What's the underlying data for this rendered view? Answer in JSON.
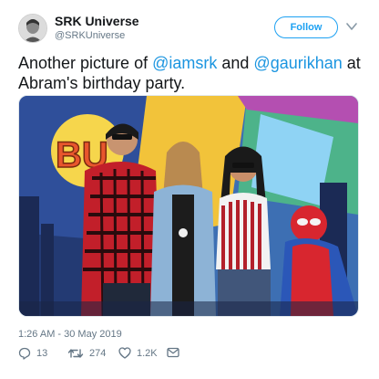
{
  "account": {
    "name": "SRK Universe",
    "handle": "@SRKUniverse"
  },
  "follow_label": "Follow",
  "tweet": {
    "part1": "Another picture of ",
    "mention1": "@iamsrk",
    "part2": " and ",
    "mention2": "@gaurikhan",
    "part3": " at Abram's birthday party."
  },
  "photo": {
    "wall_text": "BU"
  },
  "timestamp": "1:26 AM - 30 May 2019",
  "actions": {
    "replies": "13",
    "retweets": "274",
    "likes": "1.2K"
  },
  "colors": {
    "accent": "#1da1f2",
    "mention": "#1b95e0",
    "meta": "#657786"
  },
  "icons": [
    "avatar",
    "chevron-down-icon",
    "reply-icon",
    "retweet-icon",
    "like-icon",
    "message-icon"
  ]
}
